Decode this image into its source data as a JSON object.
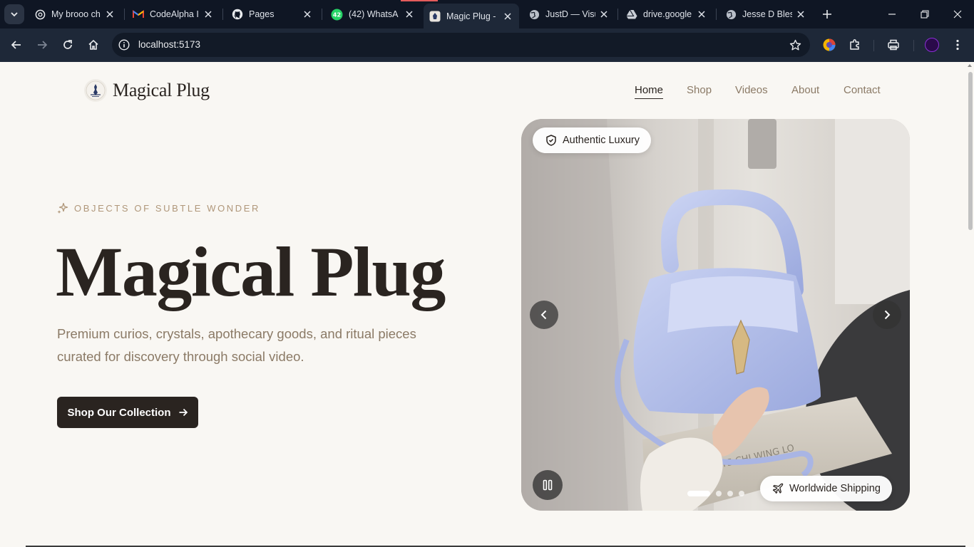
{
  "browser": {
    "tabs": [
      {
        "title": "My brooo ch",
        "icon": "chatgpt-icon"
      },
      {
        "title": "CodeAlpha I",
        "icon": "gmail-icon"
      },
      {
        "title": "Pages",
        "icon": "github-icon"
      },
      {
        "title": "(42) WhatsA",
        "icon": "whatsapp-icon",
        "badge": "42"
      },
      {
        "title": "Magic Plug -",
        "icon": "site-favicon",
        "active": true
      },
      {
        "title": "JustD — Visu",
        "icon": "globe-icon"
      },
      {
        "title": "drive.google",
        "icon": "drive-icon"
      },
      {
        "title": "Jesse D Bless",
        "icon": "globe-icon"
      }
    ],
    "url": "localhost:5173"
  },
  "site": {
    "logo_text": "Magical Plug",
    "nav": [
      {
        "label": "Home",
        "active": true
      },
      {
        "label": "Shop"
      },
      {
        "label": "Videos"
      },
      {
        "label": "About"
      },
      {
        "label": "Contact"
      }
    ]
  },
  "hero": {
    "eyebrow": "OBJECTS OF SUBTLE WONDER",
    "title": "Magical Plug",
    "subtitle": "Premium curios, crystals, apothecary goods, and ritual pieces curated for discovery through social video.",
    "cta_label": "Shop Our Collection"
  },
  "carousel": {
    "badge_top": "Authentic Luxury",
    "badge_bottom": "Worldwide Shipping",
    "dots_total": 4,
    "active_dot": 0,
    "box_text": "ARTS  CHI WING LO"
  },
  "colors": {
    "ink": "#2a2420",
    "muted": "#8b7a66",
    "accent": "#b0977a",
    "page_bg": "#f9f7f3",
    "bag": "#b9c4ec"
  }
}
